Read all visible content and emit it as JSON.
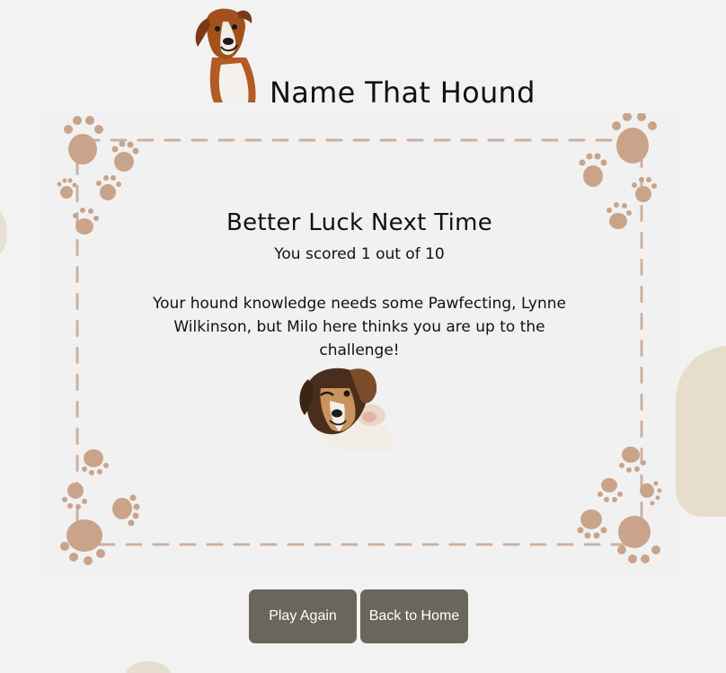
{
  "header": {
    "title": "Name That Hound"
  },
  "result": {
    "heading": "Better Luck Next Time",
    "score_text": "You scored 1 out of 10",
    "message": "Your hound knowledge needs some Pawfecting, Lynne Wilkinson, but Milo here thinks you are up to the challenge!"
  },
  "buttons": {
    "play_again": "Play Again",
    "back_home": "Back to Home"
  },
  "colors": {
    "background": "#f2f2f2",
    "paw": "#c9a48a",
    "button": "#6b665b",
    "frame_dash": "#cdb19f"
  },
  "icons": [
    "boxer-dog-image",
    "paw-print-icon",
    "winking-beagle-image"
  ]
}
